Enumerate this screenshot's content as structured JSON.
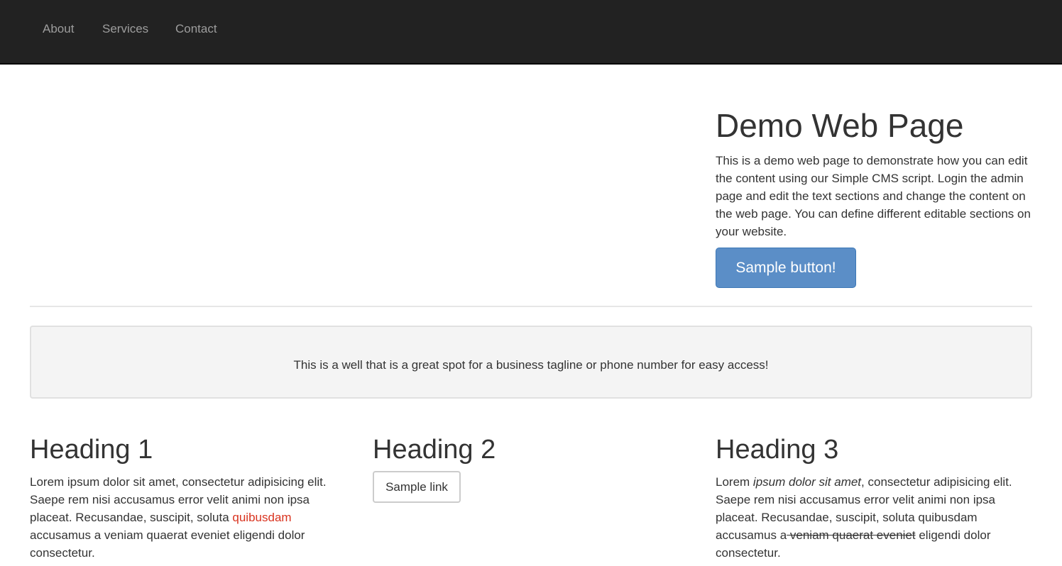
{
  "nav": {
    "items": [
      {
        "label": "About"
      },
      {
        "label": "Services"
      },
      {
        "label": "Contact"
      }
    ]
  },
  "hero": {
    "title": "Demo Web Page",
    "text": "This is a demo web page to demonstrate how you can edit the content using our Simple CMS script. Login the admin page and edit the text sections and change the content on the web page. You can define different editable sections on your website.",
    "button_label": "Sample button!",
    "button_color": "#5b8ec7"
  },
  "well": {
    "text": "This is a well that is a great spot for a business tagline or phone number for easy access!"
  },
  "columns": [
    {
      "heading": "Heading 1",
      "text_before_link": "Lorem ipsum dolor sit amet, consectetur adipisicing elit. Saepe rem nisi accusamus error velit animi non ipsa placeat. Recusandae, suscipit, soluta ",
      "link_text": "quibusdam",
      "text_after_link": " accusamus a veniam quaerat eveniet eligendi dolor consectetur.",
      "link_color": "#d9331f"
    },
    {
      "heading": "Heading 2",
      "link_button_label": "Sample link"
    },
    {
      "heading": "Heading 3",
      "text_start": "Lorem ",
      "text_italic": "ipsum dolor sit amet",
      "text_middle": ", consectetur adipisicing elit. Saepe rem nisi accusamus error velit animi non ipsa placeat. Recusandae, suscipit, soluta quibusdam accusamus a",
      "text_strike": " veniam quaerat eveniet",
      "text_end": " eligendi dolor consectetur."
    }
  ],
  "colors": {
    "navbar_bg": "#222222",
    "nav_text": "#9d9d9d",
    "body_text": "#333333",
    "well_bg": "#f4f4f4"
  }
}
